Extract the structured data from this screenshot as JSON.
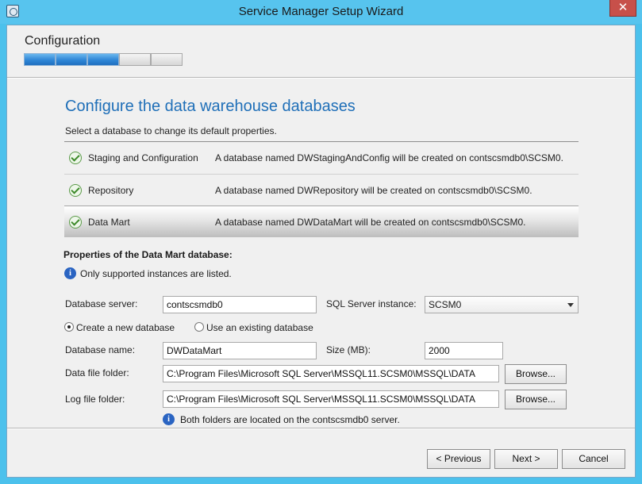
{
  "window": {
    "title": "Service Manager Setup Wizard",
    "close_glyph": "✕"
  },
  "header": {
    "section": "Configuration",
    "progress_steps_total": 5,
    "progress_steps_done": 3
  },
  "page": {
    "title": "Configure the data warehouse databases",
    "subtitle": "Select a database to change its default properties."
  },
  "databases": [
    {
      "name": "Staging and Configuration",
      "description": "A database named DWStagingAndConfig will be created on contscsmdb0\\SCSM0.",
      "selected": false
    },
    {
      "name": "Repository",
      "description": "A database named DWRepository will be created on contscsmdb0\\SCSM0.",
      "selected": false
    },
    {
      "name": "Data Mart",
      "description": "A database named DWDataMart will be created on contscsmdb0\\SCSM0.",
      "selected": true
    }
  ],
  "properties": {
    "heading": "Properties of the Data Mart database:",
    "info_instances": "Only supported instances are listed.",
    "database_server_label": "Database server:",
    "database_server_value": "contscsmdb0",
    "sql_instance_label": "SQL Server instance:",
    "sql_instance_value": "SCSM0",
    "radio_create": "Create a new database",
    "radio_existing": "Use an existing database",
    "database_name_label": "Database name:",
    "database_name_value": "DWDataMart",
    "size_label": "Size (MB):",
    "size_value": "2000",
    "data_folder_label": "Data file folder:",
    "data_folder_value": "C:\\Program Files\\Microsoft SQL Server\\MSSQL11.SCSM0\\MSSQL\\DATA",
    "log_folder_label": "Log file folder:",
    "log_folder_value": "C:\\Program Files\\Microsoft SQL Server\\MSSQL11.SCSM0\\MSSQL\\DATA",
    "browse_label": "Browse...",
    "info_folders": "Both folders are located on the contscsmdb0 server."
  },
  "footer": {
    "previous": "< Previous",
    "next": "Next >",
    "cancel": "Cancel"
  },
  "colors": {
    "title_blue": "#1f6fb8",
    "window_frame": "#4cc1ec",
    "close_red": "#c7504a",
    "progress_blue": "#2f86d6"
  },
  "icons": {
    "check": "check-circle-icon",
    "info": "info-icon",
    "dropdown": "chevron-down-icon"
  }
}
